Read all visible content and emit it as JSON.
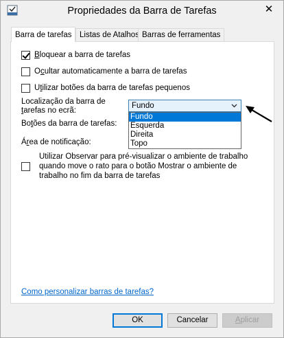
{
  "window": {
    "title": "Propriedades da Barra de Tarefas",
    "close_symbol": "✕"
  },
  "tabs": [
    {
      "label": "Barra de tarefas",
      "active": true
    },
    {
      "label": "Listas de Atalhos",
      "active": false
    },
    {
      "label": "Barras de ferramentas",
      "active": false
    }
  ],
  "options": {
    "lock_pre": "",
    "lock_mnemonic": "B",
    "lock_post": "loquear a barra de tarefas",
    "lock_checked": true,
    "autohide_pre": "O",
    "autohide_mnemonic": "c",
    "autohide_post": "ultar automaticamente a barra de tarefas",
    "autohide_checked": false,
    "small_pre": "U",
    "small_mnemonic": "t",
    "small_post": "ilizar botões da barra de tarefas pequenos",
    "small_checked": false
  },
  "location": {
    "label_line1": "Localização da barra de",
    "label_line2_pre": "",
    "label_line2_mnemonic": "t",
    "label_line2_post": "arefas no ecrã:",
    "selected": "Fundo",
    "items": [
      "Fundo",
      "Esquerda",
      "Direita",
      "Topo"
    ]
  },
  "buttons_label": {
    "pre": "Bo",
    "mnemonic": "t",
    "post": "ões da barra de tarefas:"
  },
  "notification_label": {
    "pre": "Á",
    "mnemonic": "r",
    "post": "ea de notificação:"
  },
  "observe": {
    "text": "Utilizar Observar para pré-visualizar o ambiente de trabalho quando move o rato para o botão Mostrar o ambiente de trabalho no fim da barra de tarefas",
    "checked": false
  },
  "customize_link": "Como personalizar barras de tarefas?",
  "footer": {
    "ok": "OK",
    "cancel": "Cancelar",
    "apply_mnemonic": "A",
    "apply_post": "plicar"
  }
}
